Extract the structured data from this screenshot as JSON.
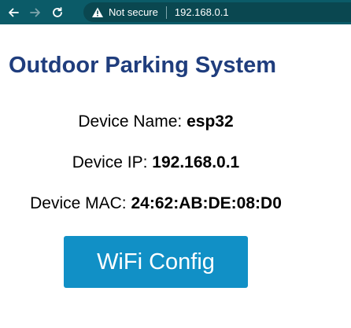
{
  "browser": {
    "security_label": "Not secure",
    "url": "192.168.0.1",
    "colors": {
      "toolbar": "#0b5b68",
      "omnibox": "#0a4750"
    }
  },
  "page": {
    "title": "Outdoor Parking System",
    "device_name_label": "Device Name:",
    "device_name": "esp32",
    "device_ip_label": "Device IP:",
    "device_ip": "192.168.0.1",
    "device_mac_label": "Device MAC:",
    "device_mac": "24:62:AB:DE:08:D0",
    "wifi_button_label": "WiFi Config",
    "colors": {
      "title": "#1f3d7d",
      "button": "#1190c6"
    }
  }
}
